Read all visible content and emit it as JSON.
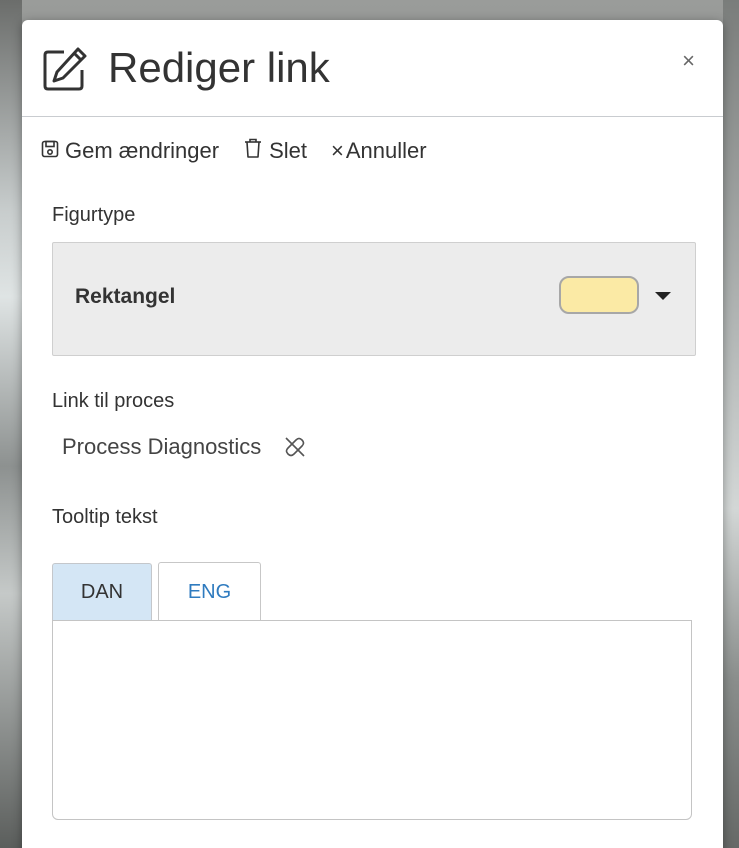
{
  "dialog": {
    "title": "Rediger link",
    "close_label": "×"
  },
  "toolbar": {
    "save_label": "Gem ændringer",
    "delete_label": "Slet",
    "cancel_label": "Annuller"
  },
  "form": {
    "figure_type_label": "Figurtype",
    "figure_type_value": "Rektangel",
    "figure_color": "#fbeaa5",
    "process_link_label": "Link til proces",
    "process_link_value": "Process Diagnostics",
    "tooltip_label": "Tooltip tekst",
    "tooltip_value": ""
  },
  "language_tabs": [
    {
      "label": "DAN",
      "selected": true
    },
    {
      "label": "ENG",
      "selected": false
    }
  ],
  "icons": {
    "title": "edit-icon",
    "save": "save-icon",
    "delete": "trash-icon",
    "cancel": "close-icon",
    "unlink": "unlink-icon",
    "dropdown": "caret-down-icon"
  },
  "colors": {
    "tab_active_bg": "#d4e6f5",
    "tab_inactive_text": "#2f7bbf"
  }
}
